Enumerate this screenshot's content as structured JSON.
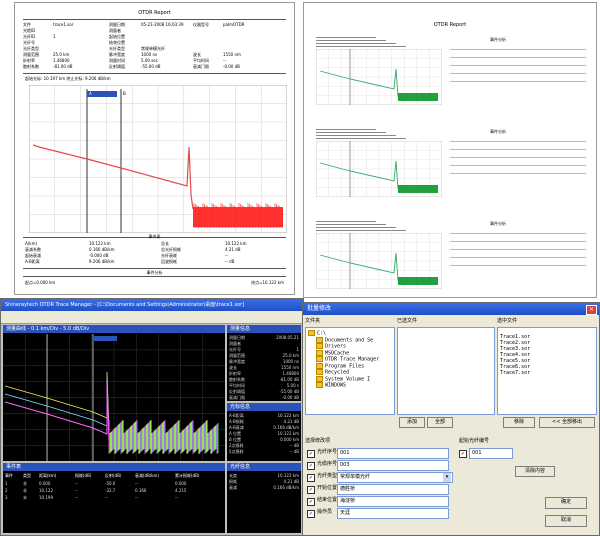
{
  "report_left": {
    "title": "OTDR Report",
    "header_rows": [
      [
        "文件",
        "trace1.sor",
        "测量日期",
        "05-21-2008 16:03:39",
        "仪器型号",
        "palmOTDR"
      ],
      [
        "光缆ID",
        "",
        "测量者",
        "",
        "",
        ""
      ],
      [
        "光纤ID",
        "1",
        "起始位置",
        "",
        "",
        ""
      ],
      [
        "光纤号",
        "",
        "结束位置",
        "",
        "",
        ""
      ],
      [
        "光纤类型",
        "",
        "光纤类型",
        "常规单模光纤",
        "",
        ""
      ],
      [
        "测量范围",
        "25.0 km",
        "脉冲宽度",
        "1000 ns",
        "波长",
        "1550 nm"
      ],
      [
        "折射率",
        "1.46800",
        "测量时间",
        "5.00 sec",
        "平均时间",
        "--"
      ],
      [
        "散射系数",
        "-81.00 dB",
        "反射阈值",
        "-55.00 dB",
        "衰减门限",
        "-0.00 dB"
      ]
    ],
    "trace_readout": "起始光标: 10.197 km 终止光标: 9.206 dB/km",
    "cursor_a": "A",
    "cursor_b": "B",
    "events_header": "事件表",
    "summary_left": [
      [
        "A(km)",
        "10.122 km"
      ],
      [
        "衰减系数",
        "0.166 dB/km"
      ],
      [
        "起始衰减",
        "-0.000 dB"
      ],
      [
        "A-B距离",
        "9.206 dB/km"
      ]
    ],
    "summary_right": [
      [
        "总长",
        "10.122 km"
      ],
      [
        "总光纤损耗",
        "4.21 dB"
      ],
      [
        "光纤衰耗",
        "--"
      ],
      [
        "回波损耗",
        "-- dB"
      ]
    ],
    "footer_title": "事件分析",
    "footer_left": "起点=0.000 km",
    "footer_right": "终点=10.122 km"
  },
  "report_right": {
    "title": "OTDR Report",
    "block_header": "事件分析",
    "block_count": 3
  },
  "main_window": {
    "title": "Shineraytech OTDR Trace Manager - [C:\\Documents and Settings\\Administrator\\桌面\\trace1.sor]",
    "trace_panel_title": "测量曲线  - 0.1 km/Div  - 5.0 dB/Div",
    "info_panel_title": "测量信息",
    "info_rows": [
      [
        "测量日期",
        "2008.05.21"
      ],
      [
        "测量者",
        ""
      ],
      [
        "光纤号",
        "1"
      ],
      [
        "测量范围",
        "25.0 km"
      ],
      [
        "脉冲宽度",
        "1000 ns"
      ],
      [
        "波长",
        "1550 nm"
      ],
      [
        "折射率",
        "1.46800"
      ],
      [
        "散射系数",
        "-81.00 dB"
      ],
      [
        "平均时间",
        "5.00 s"
      ],
      [
        "反射阈值",
        "-55.00 dB"
      ],
      [
        "衰减门限",
        "-0.00 dB"
      ]
    ],
    "marker_panel_title": "光标信息",
    "marker_rows": [
      [
        "A-B距离",
        "10.122 km"
      ],
      [
        "A-B损耗",
        "4.21 dB"
      ],
      [
        "A-B衰减",
        "0.166 dB/km"
      ],
      [
        "A 位置",
        "10.122 km"
      ],
      [
        "B 位置",
        "0.000 km"
      ],
      [
        "2点损耗",
        "-- dB"
      ],
      [
        "5点损耗",
        "-- dB"
      ]
    ],
    "event_panel_title": "事件表",
    "event_columns": [
      "事件",
      "类型",
      "距离(km)",
      "损耗(dB)",
      "反射(dB)",
      "衰减(dB/km)",
      "累计损耗(dB)"
    ],
    "event_rows": [
      [
        "1",
        "非",
        "0.000",
        "--",
        "-50.0",
        "--",
        "0.000"
      ],
      [
        "2",
        "非",
        "10.122",
        "--",
        "-32.7",
        "0.166",
        "4.215"
      ],
      [
        "3",
        "末",
        "10.199",
        "--",
        "--",
        "--",
        "--"
      ]
    ],
    "summary_panel_title": "光纤信息",
    "summary_rows": [
      [
        "长度",
        "10.122 km"
      ],
      [
        "损耗",
        "4.21 dB"
      ],
      [
        "衰减",
        "0.166 dB/km"
      ]
    ]
  },
  "dialog": {
    "title": "批量修改",
    "folder_label": "文件夹",
    "folder_value": "C:\\",
    "selected_files_label": "已选文件",
    "selected_files_list_label": "选中文件",
    "tree": [
      "C:\\",
      "Documents and Se",
      "Drivers",
      "MSOCache",
      "OTDR Trace Manager",
      "Program Files",
      "Recycled",
      "System Volume I",
      "WINDOWS"
    ],
    "selected_files": [
      "Trace1.sor",
      "Trace2.sor",
      "Trace3.sor",
      "Trace4.sor",
      "Trace5.sor",
      "Trace6.sor",
      "Trace7.sor"
    ],
    "btn_add": "添加",
    "btn_all": "全部",
    "btn_remove": "移除",
    "btn_remove_all": "<< 全部移出",
    "change_items_label": "选择修改项",
    "start_number_label": "起始光纤编号",
    "fields": [
      {
        "label": "光纤序号",
        "value": "001"
      },
      {
        "label": "光缆序号",
        "value": "003"
      },
      {
        "label": "光纤类型",
        "value": "常规单模光纤"
      },
      {
        "label": "开始位置",
        "value": "德胜桥"
      },
      {
        "label": "结束位置",
        "value": "海淀桥"
      },
      {
        "label": "操作员",
        "value": "天涯"
      }
    ],
    "start_number": "001",
    "btn_clear": "清除内容",
    "btn_ok": "确定",
    "btn_cancel": "取消"
  }
}
